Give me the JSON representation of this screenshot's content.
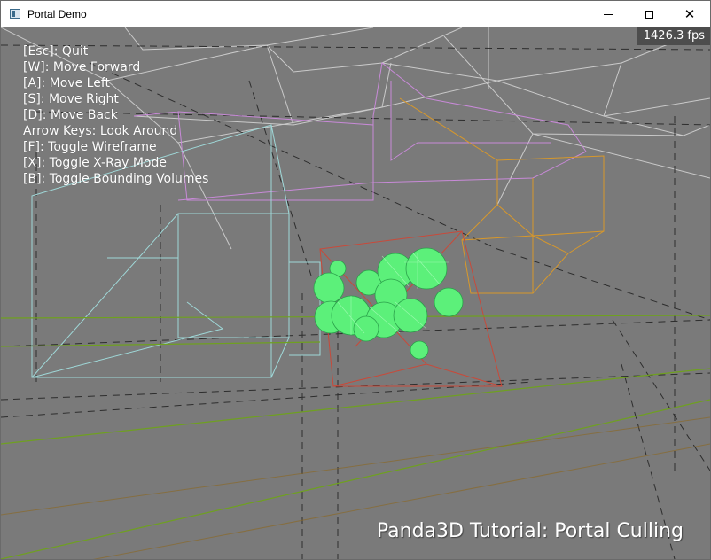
{
  "window": {
    "title": "Portal Demo",
    "controls": {
      "minimize": "minimize",
      "maximize": "maximize",
      "close": "✕"
    }
  },
  "viewport": {
    "fps": "1426.3 fps",
    "instructions": [
      "[Esc]: Quit",
      "[W]: Move Forward",
      "[A]: Move Left",
      "[S]: Move Right",
      "[D]: Move Back",
      "Arrow Keys: Look Around",
      "[F]: Toggle Wireframe",
      "[X]: Toggle X-Ray Mode",
      "[B]: Toggle Bounding Volumes"
    ],
    "caption": "Panda3D Tutorial: Portal Culling"
  },
  "colors": {
    "background": "#7a7a7a",
    "wireframe_white": "#d8d8d8",
    "wireframe_cyan": "#9fd8d8",
    "wireframe_purple": "#c88ad8",
    "wireframe_orange": "#d8982a",
    "wireframe_red": "#c84a3a",
    "ground_green": "#6fa020",
    "spheres": "#5cf07a",
    "fps_bg": "#4d4d4d"
  }
}
